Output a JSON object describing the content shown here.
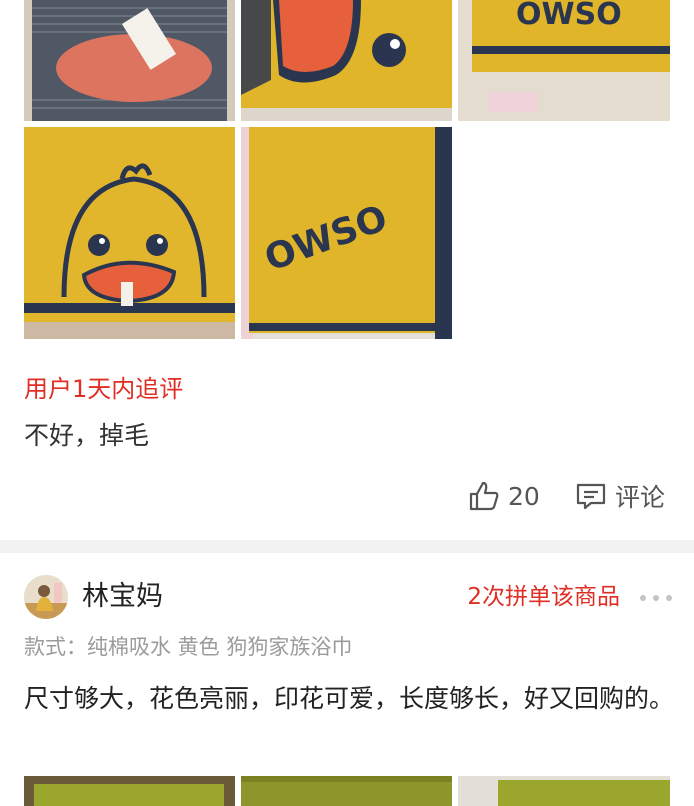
{
  "review_1": {
    "followup_label": "用户1天内追评",
    "followup_text": "不好，掉毛",
    "like_count": "20",
    "comment_label": "评论"
  },
  "review_2": {
    "username": "林宝妈",
    "group_buy_badge": "2次拼单该商品",
    "variant": "款式：纯棉吸水 黄色 狗狗家族浴巾",
    "text": "尺寸够大，花色亮丽，印花可爱，长度够长，好又回购的。"
  },
  "photos_1": [
    "photo-packaged-towel",
    "photo-duck-closeup",
    "photo-oswso-text",
    "photo-duck-face",
    "photo-oswso-hanging"
  ],
  "photos_2": [
    "photo-green-towel-1",
    "photo-green-towel-2",
    "photo-green-towel-3"
  ],
  "colors": {
    "accent_red": "#e02e24",
    "towel_yellow": "#e0b52a",
    "towel_navy": "#2a3550",
    "divider_gray": "#f2f2f2"
  },
  "icons": [
    "thumbs-up-icon",
    "comment-icon",
    "more-icon"
  ]
}
